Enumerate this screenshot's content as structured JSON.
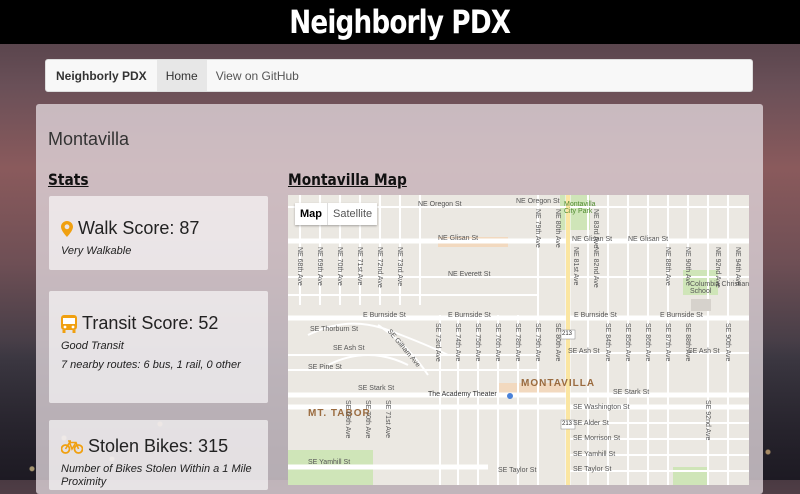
{
  "site": {
    "title": "Neighborly PDX"
  },
  "navbar": {
    "brand": "Neighborly PDX",
    "items": [
      {
        "label": "Home",
        "active": true
      },
      {
        "label": "View on GitHub",
        "active": false
      }
    ]
  },
  "neighborhood": {
    "name": "Montavilla"
  },
  "stats": {
    "heading": "Stats",
    "walk": {
      "label": "Walk Score: 87",
      "desc": "Very Walkable",
      "icon": "map-pin-icon"
    },
    "transit": {
      "label": "Transit Score: 52",
      "desc": "Good Transit",
      "routes": "7 nearby routes: 6 bus, 1 rail, 0 other",
      "icon": "bus-icon"
    },
    "bikes": {
      "label": "Stolen Bikes: 315",
      "desc": "Number of Bikes Stolen Within a 1 Mile Proximity",
      "icon": "bicycle-icon"
    }
  },
  "map": {
    "heading": "Montavilla Map",
    "toggle": {
      "map": "Map",
      "satellite": "Satellite"
    },
    "labels": {
      "ne_oregon": "NE Oregon St",
      "ne_glisan_w": "NE Glisan St",
      "ne_glisan_e": "NE Glisan St",
      "ne_everett": "NE Everett St",
      "park": "Montavilla City Park",
      "school": "Columbia Christian School",
      "e_burnside_w": "E Burnside St",
      "e_burnside_c": "E Burnside St",
      "e_burnside_e": "E Burnside St",
      "se_thorburn": "SE Thorburn St",
      "se_ash": "SE Ash St",
      "se_ash_e": "SE Ash St",
      "se_pine": "SE Pine St",
      "se_stark": "SE Stark St",
      "se_stark_e": "SE Stark St",
      "montavilla": "MONTAVILLA",
      "mt_tabor": "MT. TABOR",
      "theater": "The Academy Theater",
      "washington": "SE Washington St",
      "alder": "SE Alder St",
      "morrison": "SE Morrison St",
      "yamhill": "SE Yamhill St",
      "taylor_w": "SE Taylor St",
      "taylor_e": "SE Taylor St",
      "ne_68": "NE 68th Ave",
      "ne_69": "NE 69th Ave",
      "ne_70": "NE 70th Ave",
      "ne_71": "NE 71st Ave",
      "ne_72": "NE 72nd Ave",
      "ne_73": "NE 73rd Ave",
      "ne_79": "NE 79th Ave",
      "ne_80": "NE 80th Ave",
      "ne_81": "NE 81st Ave",
      "ne_82": "NE 82nd Ave",
      "ne_83": "NE 83rd Ave",
      "ne_88": "NE 88th Ave",
      "ne_90": "NE 90th Ave",
      "ne_92": "NE 92nd Ave",
      "ne_94": "NE 94th Ave",
      "se_73": "SE 73rd Ave",
      "se_74": "SE 74th Ave",
      "se_75": "SE 75th Ave",
      "se_76": "SE 76th Ave",
      "se_78": "SE 78th Ave",
      "se_79": "SE 79th Ave",
      "se_80": "SE 80th Ave",
      "se_81": "SE 81st Ave",
      "se_82": "SE 82nd Ave",
      "se_84": "SE 84th Ave",
      "se_85": "SE 85th Ave",
      "se_86": "SE 86th Ave",
      "se_87": "SE 87th Ave",
      "se_88": "SE 88th Ave",
      "se_90": "SE 90th Ave",
      "se_92": "SE 92nd Ave",
      "se_69": "SE 69th Ave",
      "se_70": "SE 70th Ave",
      "se_71": "SE 71st Ave",
      "se_gilham": "SE Gilham Ave",
      "shield": "213"
    }
  }
}
